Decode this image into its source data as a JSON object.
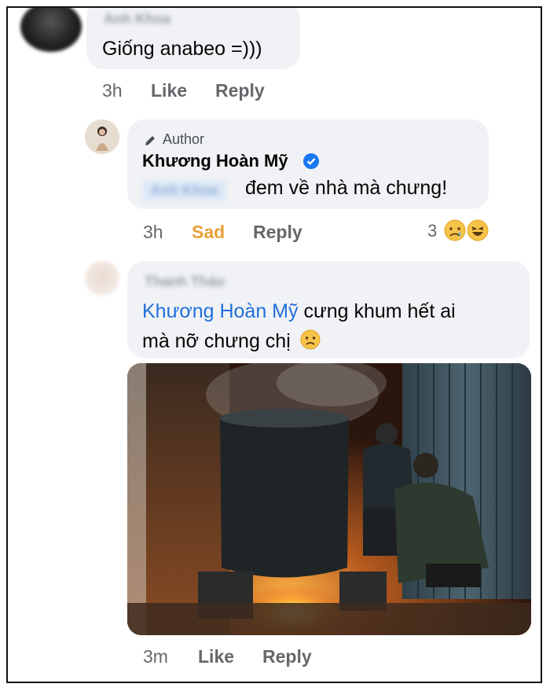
{
  "comments": [
    {
      "author_blurred": "Anh Khoa",
      "text": "Giống anabeo =)))",
      "time": "3h",
      "actions": [
        "Like",
        "Reply"
      ]
    },
    {
      "badge": "Author",
      "author": "Khương Hoàn Mỹ",
      "mention_blurred": "Anh Khoa",
      "text": "đem về nhà mà chưng!",
      "time": "3h",
      "actions": [
        "Sad",
        "Reply"
      ],
      "reaction_count": "3"
    },
    {
      "author_blurred": "Thanh Thảo",
      "mention": "Khương Hoàn Mỹ",
      "text_line1": "cưng khum hết ai",
      "text_line2": "mà nỡ chưng chị",
      "time": "3m",
      "actions": [
        "Like",
        "Reply"
      ]
    }
  ],
  "colors": {
    "bubble": "#f0f2f5",
    "link": "#216fdb",
    "sad": "#e8a13a",
    "verified": "#1877f2",
    "meta": "#65676b"
  },
  "icons": [
    "pencil-icon",
    "verified-badge-icon",
    "sad-reaction-icon",
    "haha-reaction-icon",
    "frowning-face-emoji"
  ]
}
